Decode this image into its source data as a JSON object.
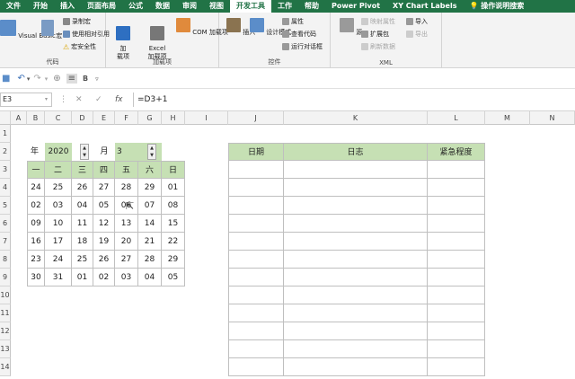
{
  "tabs": [
    "文件",
    "开始",
    "插入",
    "页面布局",
    "公式",
    "数据",
    "审阅",
    "视图",
    "开发工具",
    "工作",
    "帮助",
    "Power Pivot",
    "XY Chart Labels",
    "操作说明搜索"
  ],
  "active_tab_index": 8,
  "ribbon": {
    "code": {
      "label": "代码",
      "visual_basic": "Visual Basic",
      "macros": "宏",
      "record_macro": "录制宏",
      "relative_ref": "使用相对引用",
      "macro_security": "宏安全性"
    },
    "addins": {
      "label": "加载项",
      "addins_btn": "加\n载项",
      "excel_addins": "Excel\n加载项",
      "com_addins": "COM 加载项"
    },
    "controls": {
      "label": "控件",
      "insert": "插入",
      "design_mode": "设计模式",
      "properties": "属性",
      "view_code": "查看代码",
      "run_dialog": "运行对话框"
    },
    "xml": {
      "label": "XML",
      "source": "源",
      "map_props": "映射属性",
      "expansion_packs": "扩展包",
      "refresh_data": "刷新数据",
      "import": "导入",
      "export": "导出"
    }
  },
  "formula_bar": {
    "name_box": "E3",
    "cancel": "✕",
    "enter": "✓",
    "fx": "fx",
    "formula": "=D3+1"
  },
  "columns": [
    "A",
    "B",
    "C",
    "D",
    "E",
    "F",
    "G",
    "H",
    "I",
    "J",
    "K",
    "L",
    "M",
    "N"
  ],
  "rows": [
    "1",
    "2",
    "3",
    "4",
    "5",
    "6",
    "7",
    "8",
    "9",
    "10",
    "11",
    "12",
    "13",
    "14"
  ],
  "calendar": {
    "year_label": "年",
    "year": "2020",
    "month_label": "月",
    "month": "3",
    "weekdays": [
      "一",
      "二",
      "三",
      "四",
      "五",
      "六",
      "日"
    ],
    "weeks": [
      [
        "24",
        "25",
        "26",
        "27",
        "28",
        "29",
        "01"
      ],
      [
        "02",
        "03",
        "04",
        "05",
        "06",
        "07",
        "08"
      ],
      [
        "09",
        "10",
        "11",
        "12",
        "13",
        "14",
        "15"
      ],
      [
        "16",
        "17",
        "18",
        "19",
        "20",
        "21",
        "22"
      ],
      [
        "23",
        "24",
        "25",
        "26",
        "27",
        "28",
        "29"
      ],
      [
        "30",
        "31",
        "01",
        "02",
        "03",
        "04",
        "05"
      ]
    ]
  },
  "log_table": {
    "headers": [
      "日期",
      "日志",
      "紧急程度"
    ]
  },
  "colors": {
    "accent": "#217346",
    "header_green": "#c6e0b4"
  }
}
